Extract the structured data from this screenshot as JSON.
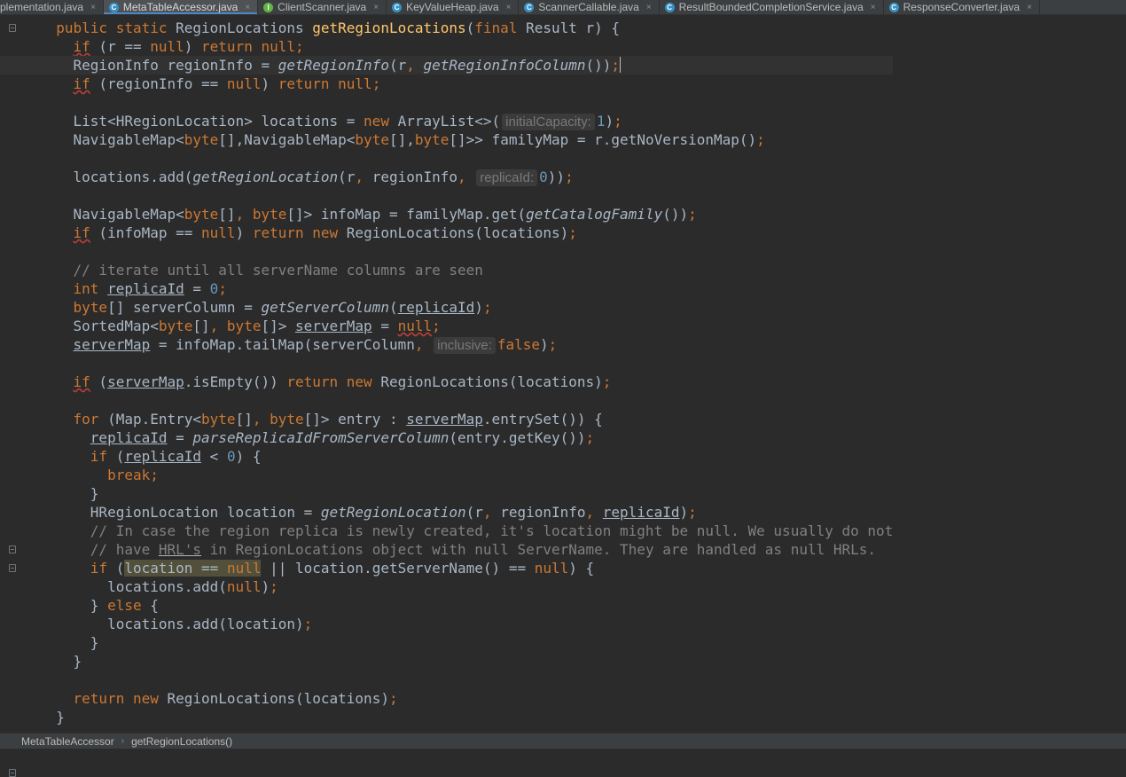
{
  "tabs": [
    {
      "label": "plementation.java",
      "icon": "none",
      "active": false
    },
    {
      "label": "MetaTableAccessor.java",
      "icon": "class",
      "active": true
    },
    {
      "label": "ClientScanner.java",
      "icon": "interface",
      "active": false
    },
    {
      "label": "KeyValueHeap.java",
      "icon": "class",
      "active": false
    },
    {
      "label": "ScannerCallable.java",
      "icon": "class",
      "active": false
    },
    {
      "label": "ResultBoundedCompletionService.java",
      "icon": "class",
      "active": false
    },
    {
      "label": "ResponseConverter.java",
      "icon": "class",
      "active": false
    }
  ],
  "tab_close_glyph": "×",
  "class_icon_letter": "C",
  "interface_icon_letter": "I",
  "breadcrumb": [
    "MetaTableAccessor",
    "getRegionLocations()"
  ],
  "breadcrumb_separator": "›",
  "fold_marker_lines": [
    0,
    28,
    29,
    40
  ],
  "caret_line": 2,
  "colors": {
    "background": "#2b2b2b",
    "default_text": "#a9b7c6",
    "keyword": "#cc7832",
    "method_decl": "#ffc66d",
    "number": "#6897bb",
    "comment": "#808080",
    "tab_active_underline": "#4a88c7"
  },
  "code_lines": [
    [
      {
        "t": "  "
      },
      {
        "t": "public static ",
        "c": "kw"
      },
      {
        "t": "RegionLocations "
      },
      {
        "t": "getRegionLocations",
        "c": "fn"
      },
      {
        "t": "("
      },
      {
        "t": "final ",
        "c": "kw"
      },
      {
        "t": "Result r) {"
      }
    ],
    [
      {
        "t": "    "
      },
      {
        "t": "if",
        "c": "kw squig"
      },
      {
        "t": " (r == "
      },
      {
        "t": "null",
        "c": "kw"
      },
      {
        "t": ") "
      },
      {
        "t": "return null",
        "c": "kw"
      },
      {
        "t": ";",
        "c": "kw"
      }
    ],
    [
      {
        "t": "    RegionInfo regionInfo = "
      },
      {
        "t": "getRegionInfo",
        "c": "it"
      },
      {
        "t": "(r"
      },
      {
        "t": ", ",
        "c": "kw"
      },
      {
        "t": "getRegionInfoColumn",
        "c": "it"
      },
      {
        "t": "())"
      },
      {
        "t": ";",
        "c": "kw"
      },
      {
        "caret": true
      }
    ],
    [
      {
        "t": "    "
      },
      {
        "t": "if",
        "c": "kw squig"
      },
      {
        "t": " (regionInfo == "
      },
      {
        "t": "null",
        "c": "kw"
      },
      {
        "t": ") "
      },
      {
        "t": "return null",
        "c": "kw"
      },
      {
        "t": ";",
        "c": "kw"
      }
    ],
    [],
    [
      {
        "t": "    List<HRegionLocation> locations = "
      },
      {
        "t": "new ",
        "c": "kw"
      },
      {
        "t": "ArrayList<>("
      },
      {
        "hint": "initialCapacity:"
      },
      {
        "t": "1",
        "c": "num"
      },
      {
        "t": ")"
      },
      {
        "t": ";",
        "c": "kw"
      }
    ],
    [
      {
        "t": "    NavigableMap<"
      },
      {
        "t": "byte",
        "c": "kw"
      },
      {
        "t": "[],NavigableMap<"
      },
      {
        "t": "byte",
        "c": "kw"
      },
      {
        "t": "[],"
      },
      {
        "t": "byte",
        "c": "kw"
      },
      {
        "t": "[]>> familyMap = r.getNoVersionMap()"
      },
      {
        "t": ";",
        "c": "kw"
      }
    ],
    [],
    [
      {
        "t": "    locations.add("
      },
      {
        "t": "getRegionLocation",
        "c": "it"
      },
      {
        "t": "(r"
      },
      {
        "t": ", ",
        "c": "kw"
      },
      {
        "t": "regionInfo"
      },
      {
        "t": ", ",
        "c": "kw"
      },
      {
        "hint": "replicaId:"
      },
      {
        "t": "0",
        "c": "num"
      },
      {
        "t": "))"
      },
      {
        "t": ";",
        "c": "kw"
      }
    ],
    [],
    [
      {
        "t": "    NavigableMap<"
      },
      {
        "t": "byte",
        "c": "kw"
      },
      {
        "t": "[]"
      },
      {
        "t": ", ",
        "c": "kw"
      },
      {
        "t": "byte",
        "c": "kw"
      },
      {
        "t": "[]> infoMap = familyMap.get("
      },
      {
        "t": "getCatalogFamily",
        "c": "it"
      },
      {
        "t": "())"
      },
      {
        "t": ";",
        "c": "kw"
      }
    ],
    [
      {
        "t": "    "
      },
      {
        "t": "if",
        "c": "kw squig"
      },
      {
        "t": " (infoMap == "
      },
      {
        "t": "null",
        "c": "kw"
      },
      {
        "t": ") "
      },
      {
        "t": "return new ",
        "c": "kw"
      },
      {
        "t": "RegionLocations(locations)"
      },
      {
        "t": ";",
        "c": "kw"
      }
    ],
    [],
    [
      {
        "t": "    // iterate until all serverName columns are seen",
        "c": "cm"
      }
    ],
    [
      {
        "t": "    "
      },
      {
        "t": "int ",
        "c": "kw"
      },
      {
        "t": "replicaId",
        "c": "ul"
      },
      {
        "t": " = "
      },
      {
        "t": "0",
        "c": "num"
      },
      {
        "t": ";",
        "c": "kw"
      }
    ],
    [
      {
        "t": "    "
      },
      {
        "t": "byte",
        "c": "kw"
      },
      {
        "t": "[] serverColumn = "
      },
      {
        "t": "getServerColumn",
        "c": "it"
      },
      {
        "t": "("
      },
      {
        "t": "replicaId",
        "c": "ul"
      },
      {
        "t": ")"
      },
      {
        "t": ";",
        "c": "kw"
      }
    ],
    [
      {
        "t": "    SortedMap<"
      },
      {
        "t": "byte",
        "c": "kw"
      },
      {
        "t": "[]"
      },
      {
        "t": ", ",
        "c": "kw"
      },
      {
        "t": "byte",
        "c": "kw"
      },
      {
        "t": "[]> "
      },
      {
        "t": "serverMap",
        "c": "ul"
      },
      {
        "t": " = "
      },
      {
        "t": "null",
        "c": "kw squig"
      },
      {
        "t": ";",
        "c": "kw"
      }
    ],
    [
      {
        "t": "    "
      },
      {
        "t": "serverMap",
        "c": "ul"
      },
      {
        "t": " = infoMap.tailMap(serverColumn"
      },
      {
        "t": ", ",
        "c": "kw"
      },
      {
        "hint": "inclusive:"
      },
      {
        "t": "false",
        "c": "kw"
      },
      {
        "t": ")"
      },
      {
        "t": ";",
        "c": "kw"
      }
    ],
    [],
    [
      {
        "t": "    "
      },
      {
        "t": "if",
        "c": "kw squig"
      },
      {
        "t": " ("
      },
      {
        "t": "serverMap",
        "c": "ul"
      },
      {
        "t": ".isEmpty()) "
      },
      {
        "t": "return new ",
        "c": "kw"
      },
      {
        "t": "RegionLocations(locations)"
      },
      {
        "t": ";",
        "c": "kw"
      }
    ],
    [],
    [
      {
        "t": "    "
      },
      {
        "t": "for ",
        "c": "kw"
      },
      {
        "t": "(Map.Entry<"
      },
      {
        "t": "byte",
        "c": "kw"
      },
      {
        "t": "[]"
      },
      {
        "t": ", ",
        "c": "kw"
      },
      {
        "t": "byte",
        "c": "kw"
      },
      {
        "t": "[]> entry : "
      },
      {
        "t": "serverMap",
        "c": "ul"
      },
      {
        "t": ".entrySet()) {"
      }
    ],
    [
      {
        "t": "      "
      },
      {
        "t": "replicaId",
        "c": "ul"
      },
      {
        "t": " = "
      },
      {
        "t": "parseReplicaIdFromServerColumn",
        "c": "it"
      },
      {
        "t": "(entry.getKey())"
      },
      {
        "t": ";",
        "c": "kw"
      }
    ],
    [
      {
        "t": "      "
      },
      {
        "t": "if ",
        "c": "kw"
      },
      {
        "t": "("
      },
      {
        "t": "replicaId",
        "c": "ul"
      },
      {
        "t": " < "
      },
      {
        "t": "0",
        "c": "num"
      },
      {
        "t": ") {"
      }
    ],
    [
      {
        "t": "        "
      },
      {
        "t": "break;",
        "c": "kw"
      }
    ],
    [
      {
        "t": "      }"
      }
    ],
    [
      {
        "t": "      HRegionLocation location = "
      },
      {
        "t": "getRegionLocation",
        "c": "it"
      },
      {
        "t": "(r"
      },
      {
        "t": ", ",
        "c": "kw"
      },
      {
        "t": "regionInfo"
      },
      {
        "t": ", ",
        "c": "kw"
      },
      {
        "t": "replicaId",
        "c": "ul"
      },
      {
        "t": ")"
      },
      {
        "t": ";",
        "c": "kw"
      }
    ],
    [
      {
        "t": "      // In case the region replica is newly created, it's location might be null. We usually do not",
        "c": "cm"
      }
    ],
    [
      {
        "t": "      // have ",
        "c": "cm"
      },
      {
        "t": "HRL's",
        "c": "cm ul"
      },
      {
        "t": " in RegionLocations object with null ServerName. They are handled as null HRLs.",
        "c": "cm"
      }
    ],
    [
      {
        "t": "      "
      },
      {
        "t": "if ",
        "c": "kw"
      },
      {
        "t": "("
      },
      {
        "t": "location == ",
        "c": "hl"
      },
      {
        "t": "null",
        "c": "kw hl"
      },
      {
        "t": " || location.getServerName() == "
      },
      {
        "t": "null",
        "c": "kw"
      },
      {
        "t": ") {"
      }
    ],
    [
      {
        "t": "        locations.add("
      },
      {
        "t": "null",
        "c": "kw"
      },
      {
        "t": ")"
      },
      {
        "t": ";",
        "c": "kw"
      }
    ],
    [
      {
        "t": "      } "
      },
      {
        "t": "else ",
        "c": "kw"
      },
      {
        "t": "{"
      }
    ],
    [
      {
        "t": "        locations.add(location)"
      },
      {
        "t": ";",
        "c": "kw"
      }
    ],
    [
      {
        "t": "      }"
      }
    ],
    [
      {
        "t": "    }"
      }
    ],
    [],
    [
      {
        "t": "    "
      },
      {
        "t": "return new ",
        "c": "kw"
      },
      {
        "t": "RegionLocations(locations)"
      },
      {
        "t": ";",
        "c": "kw"
      }
    ],
    [
      {
        "t": "  }"
      }
    ]
  ]
}
